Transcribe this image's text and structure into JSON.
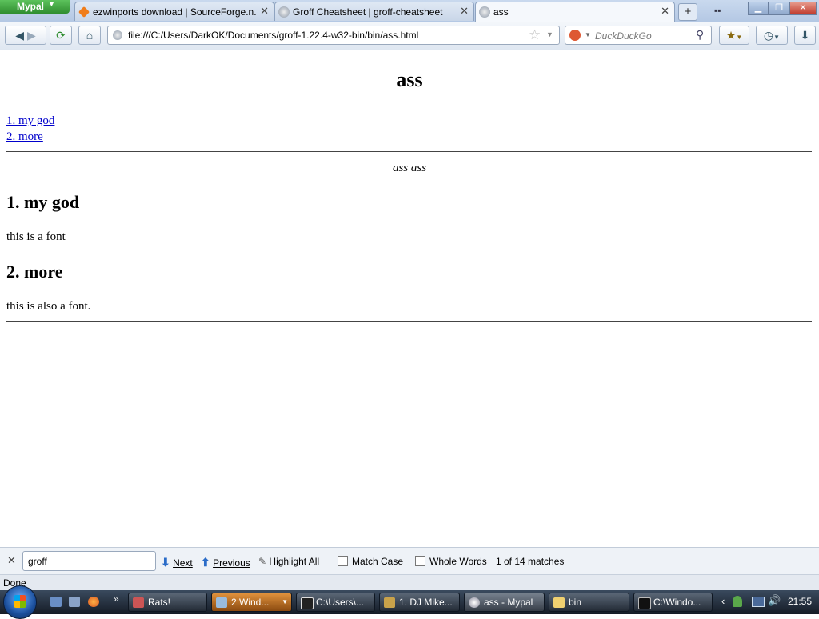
{
  "browser": {
    "app_button": "Mypal",
    "tabs": [
      {
        "title": "ezwinports download | SourceForge.n..."
      },
      {
        "title": "Groff Cheatsheet | groff-cheatsheet"
      },
      {
        "title": "ass"
      }
    ],
    "url": "file:///C:/Users/DarkOK/Documents/groff-1.22.4-w32-bin/bin/ass.html",
    "search_placeholder": "DuckDuckGo"
  },
  "page": {
    "title": "ass",
    "toc": [
      "1. my god",
      "2. more"
    ],
    "author": "ass ass",
    "sections": [
      {
        "heading": "1. my god",
        "text": "this is a font"
      },
      {
        "heading": "2. more",
        "text": "this is also a font."
      }
    ]
  },
  "findbar": {
    "query": "groff",
    "next": "Next",
    "previous": "Previous",
    "highlight_all": "Highlight All",
    "match_case": "Match Case",
    "whole_words": "Whole Words",
    "matches": "1 of 14 matches"
  },
  "statusbar": {
    "text": "Done"
  },
  "taskbar": {
    "items": [
      {
        "label": "Rats!"
      },
      {
        "label": "2 Wind..."
      },
      {
        "label": "C:\\Users\\..."
      },
      {
        "label": "1. DJ Mike..."
      },
      {
        "label": "ass - Mypal"
      },
      {
        "label": "bin"
      },
      {
        "label": "C:\\Windo..."
      }
    ],
    "clock": "21:55"
  }
}
